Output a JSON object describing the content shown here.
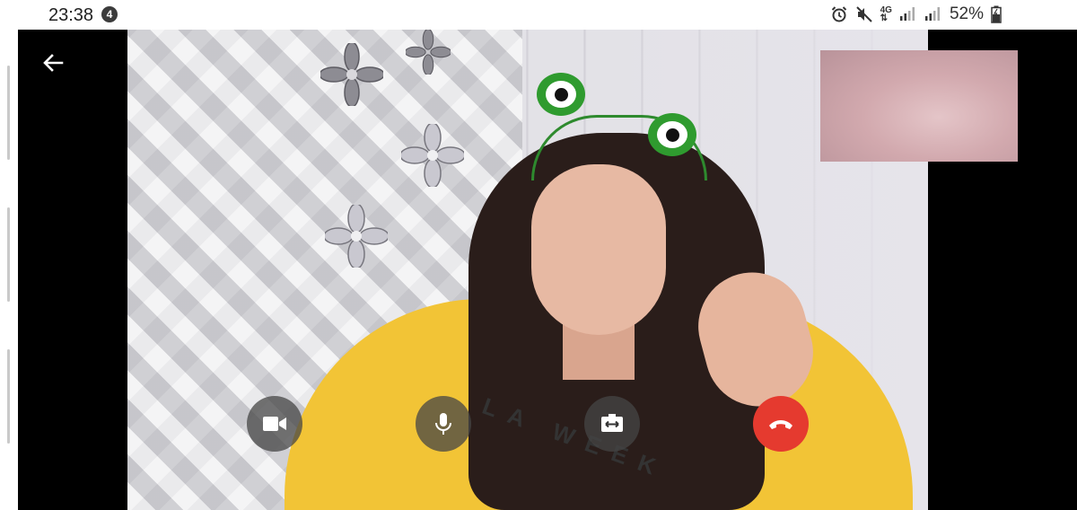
{
  "status_bar": {
    "time": "23:38",
    "notification_count": "4",
    "network_type": "4G",
    "battery_percent": "52%",
    "icons": [
      "alarm-icon",
      "mute-icon",
      "network-4g-icon",
      "signal-icon",
      "signal-icon",
      "battery-charging-icon"
    ]
  },
  "remote_video": {
    "shirt_print": "LA WEEK"
  },
  "call_controls": {
    "buttons": [
      "video-camera-icon",
      "microphone-icon",
      "switch-camera-icon",
      "end-call-icon"
    ],
    "end_call_color": "#e53a2f"
  },
  "navigation": {
    "back_icon": "arrow-left-icon"
  }
}
